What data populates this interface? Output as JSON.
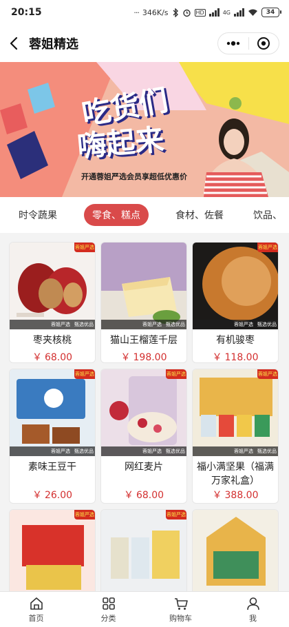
{
  "status_bar": {
    "time": "20:15",
    "dots": "···",
    "network_speed": "346K/s",
    "hd": "HD",
    "network_type": "4G",
    "battery": "34"
  },
  "header": {
    "title": "蓉姐精选"
  },
  "banner": {
    "headline_1": "吃货们",
    "headline_2": "嗨起来",
    "subtitle": "开通蓉姐严选会员享超低优惠价"
  },
  "tabs": [
    {
      "label": "时令蔬果",
      "active": false
    },
    {
      "label": "零食、糕点",
      "active": true
    },
    {
      "label": "食材、佐餐",
      "active": false
    },
    {
      "label": "饮品、",
      "active": false
    }
  ],
  "product_common": {
    "badge": "蓉姐严选",
    "strip_left": "蓉姐严选",
    "strip_right": "甄选优品",
    "currency": "￥"
  },
  "products": [
    {
      "name": "枣夹核桃",
      "price": "68.00"
    },
    {
      "name": "猫山王榴莲千层",
      "price": "198.00"
    },
    {
      "name": "有机骏枣",
      "price": "118.00"
    },
    {
      "name": "素味王豆干",
      "price": "26.00"
    },
    {
      "name": "网红麦片",
      "price": "68.00"
    },
    {
      "name": "福小满坚果（福满万家礼盒）",
      "price": "388.00"
    },
    {
      "name": "",
      "price": ""
    },
    {
      "name": "",
      "price": ""
    },
    {
      "name": "",
      "price": ""
    }
  ],
  "bottom_nav": [
    {
      "label": "首页",
      "icon": "home-icon"
    },
    {
      "label": "分类",
      "icon": "category-icon"
    },
    {
      "label": "购物车",
      "icon": "cart-icon"
    },
    {
      "label": "我",
      "icon": "user-icon"
    }
  ],
  "colors": {
    "accent": "#d94a4a",
    "price": "#d32f2f",
    "badge": "#d42c1f"
  }
}
